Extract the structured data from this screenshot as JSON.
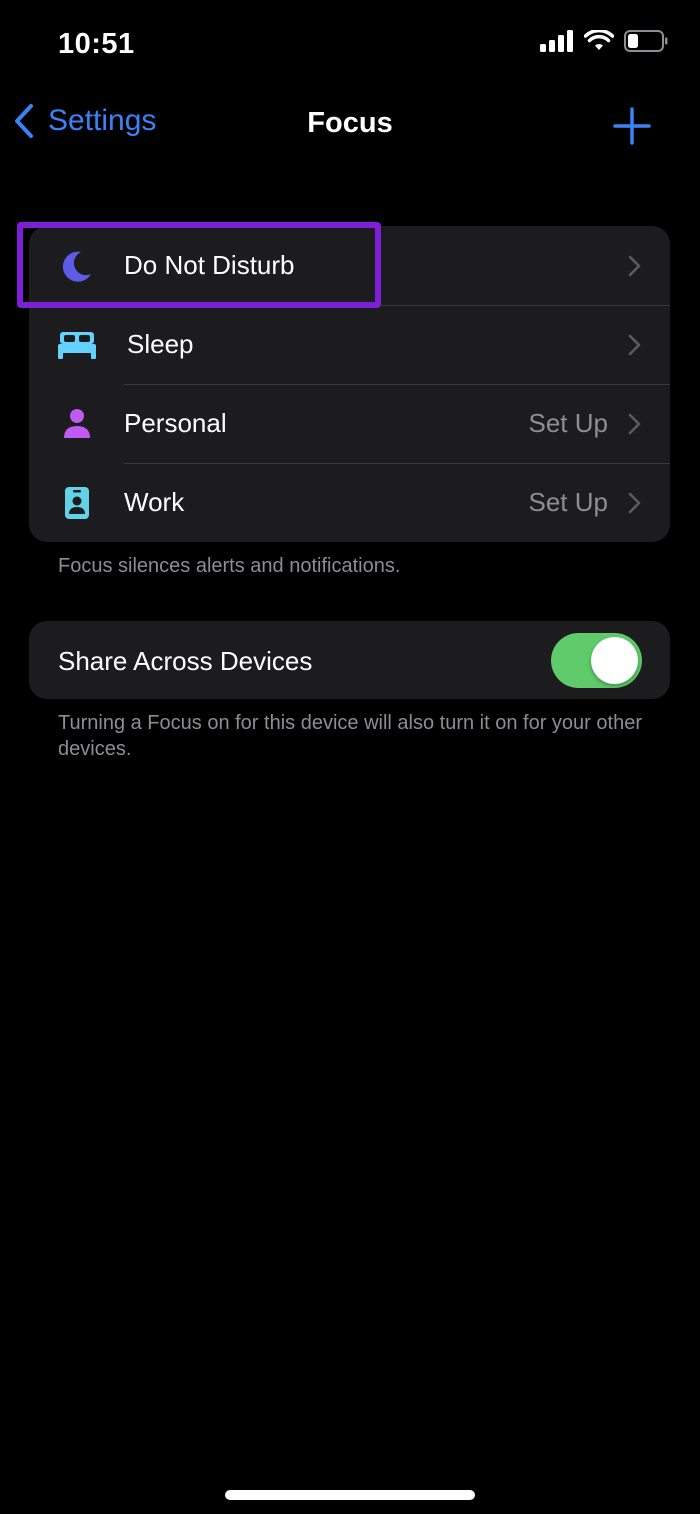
{
  "status_bar": {
    "time": "10:51",
    "icons": [
      "cellular-signal-icon",
      "wifi-icon",
      "battery-icon"
    ]
  },
  "nav": {
    "back_label": "Settings",
    "title": "Focus",
    "add_icon": "plus-icon"
  },
  "focus_modes": [
    {
      "label": "Do Not Disturb",
      "value": "",
      "icon": "moon-icon",
      "color": "#5e5ce6"
    },
    {
      "label": "Sleep",
      "value": "",
      "icon": "bed-icon",
      "color": "#64d2ff"
    },
    {
      "label": "Personal",
      "value": "Set Up",
      "icon": "person-icon",
      "color": "#bf5af2"
    },
    {
      "label": "Work",
      "value": "Set Up",
      "icon": "id-badge-icon",
      "color": "#63d2e6"
    }
  ],
  "focus_footnote": "Focus silences alerts and notifications.",
  "share": {
    "label": "Share Across Devices",
    "enabled": true,
    "footnote": "Turning a Focus on for this device will also turn it on for your other devices."
  },
  "colors": {
    "accent": "#3a82f7",
    "toggle_on": "#5fcb6a",
    "highlight": "#7c1fd6",
    "group_bg": "#1c1c1e",
    "secondary_text": "#8d8d93"
  }
}
